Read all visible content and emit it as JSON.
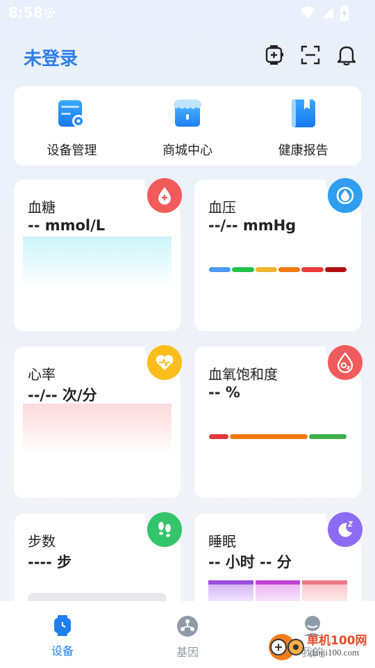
{
  "status": {
    "time": "8:58"
  },
  "header": {
    "title": "未登录"
  },
  "quick": [
    {
      "label": "设备管理",
      "icon": "device-manage-icon"
    },
    {
      "label": "商城中心",
      "icon": "shop-icon"
    },
    {
      "label": "健康报告",
      "icon": "report-book-icon"
    }
  ],
  "cards": {
    "blood_sugar": {
      "title": "血糖",
      "value": "-- mmol/L",
      "color": "#f25b5b"
    },
    "blood_pressure": {
      "title": "血压",
      "value": "--/-- mmHg",
      "color": "#2f9ef0",
      "levels": [
        "#4d9af0",
        "#22c24a",
        "#f2b630",
        "#f27a10",
        "#ec3b3b",
        "#b00f10"
      ]
    },
    "heart_rate": {
      "title": "心率",
      "value": "--/-- 次/分",
      "color": "#fbbd19"
    },
    "spo2": {
      "title": "血氧饱和度",
      "value": "-- %",
      "color": "#f25b5b",
      "levels": [
        "#e2373b",
        "#f47a0f",
        "#3bb04a"
      ]
    },
    "steps": {
      "title": "步数",
      "value": "---- 步",
      "color": "#34c46a"
    },
    "sleep": {
      "title": "睡眠",
      "value": "-- 小时 -- 分",
      "color": "#8b6cf2",
      "bars": [
        "#9b4fe0",
        "#c042d6",
        "#f07a84"
      ]
    }
  },
  "tabs": [
    {
      "label": "设备",
      "active": true
    },
    {
      "label": "基因",
      "active": false
    },
    {
      "label": "我的",
      "active": false
    }
  ],
  "watermark": {
    "brand": "单机100网",
    "url": "danji100.com"
  }
}
